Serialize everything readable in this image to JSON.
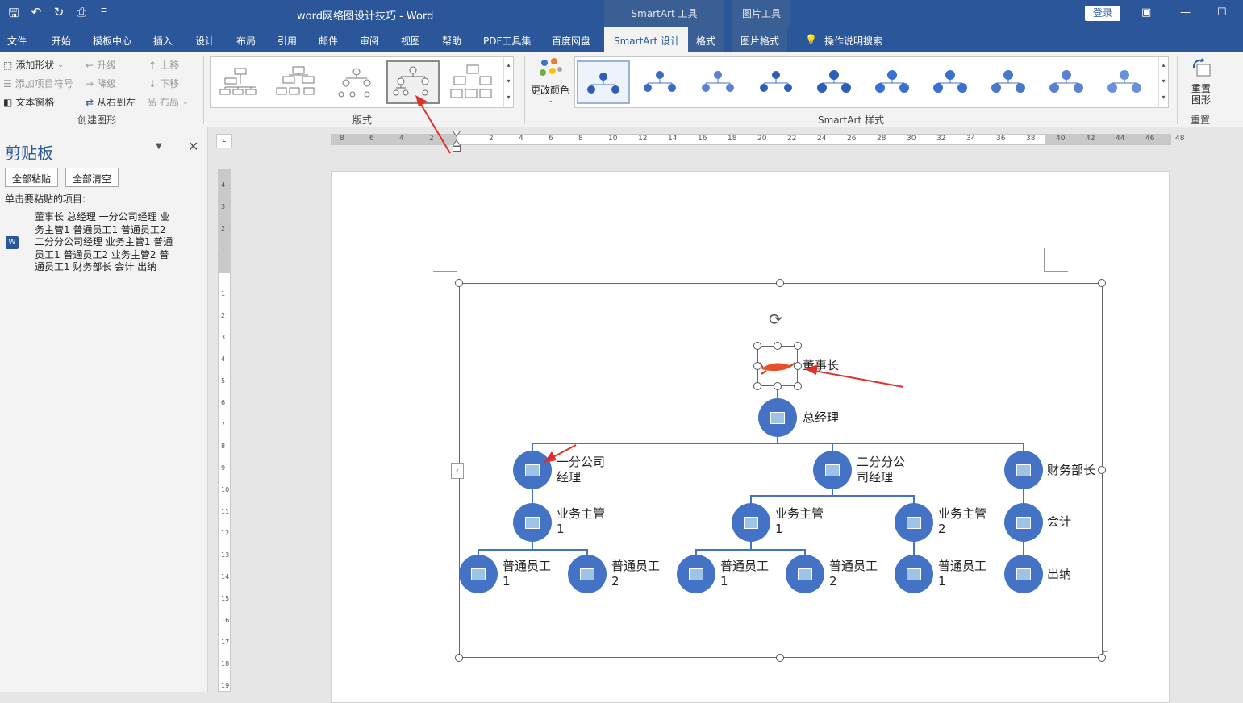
{
  "app": {
    "title": "word网络图设计技巧  -  Word",
    "context_tabs": [
      "SmartArt 工具",
      "图片工具"
    ],
    "login": "登录"
  },
  "tabs": [
    "文件",
    "开始",
    "模板中心",
    "插入",
    "设计",
    "布局",
    "引用",
    "邮件",
    "审阅",
    "视图",
    "帮助",
    "PDF工具集",
    "百度网盘",
    "SmartArt 设计",
    "格式",
    "图片格式",
    "操作说明搜索"
  ],
  "active_tab": "SmartArt 设计",
  "ribbon": {
    "create": {
      "add_shape": "添加形状",
      "add_bullet": "添加项目符号",
      "text_pane": "文本窗格",
      "promote": "升级",
      "demote": "降级",
      "rtl": "从右到左",
      "move_up": "上移",
      "move_down": "下移",
      "layout": "布局",
      "group": "创建图形"
    },
    "layouts_group": "版式",
    "change_colors": "更改颜色",
    "styles_group": "SmartArt 样式",
    "reset_graphic": "重置\n图形",
    "reset_group": "重置"
  },
  "clipboard": {
    "title": "剪贴板",
    "paste_all": "全部粘贴",
    "clear_all": "全部清空",
    "hint": "单击要粘贴的项目:",
    "item": "董事长 总经理 一分公司经理 业务主管1 普通员工1 普通员工2 二分分公司经理 业务主管1 普通员工1 普通员工2 业务主管2 普通员工1 财务部长 会计 出纳"
  },
  "ruler": {
    "h_labels": [
      "8",
      "6",
      "4",
      "2",
      "",
      "2",
      "4",
      "6",
      "8",
      "10",
      "12",
      "14",
      "16",
      "18",
      "20",
      "22",
      "24",
      "26",
      "28",
      "30",
      "32",
      "34",
      "36",
      "38",
      "40",
      "42",
      "44",
      "46",
      "48"
    ],
    "v_labels": [
      "4",
      "3",
      "2",
      "1",
      "",
      "1",
      "2",
      "3",
      "4",
      "5",
      "6",
      "7",
      "8",
      "9",
      "10",
      "11",
      "12",
      "13",
      "14",
      "15",
      "16",
      "17",
      "18",
      "19"
    ]
  },
  "org": {
    "chairman": "董事长",
    "gm": "总经理",
    "b1": "一分公司\n经理",
    "b2": "二分分公\n司经理",
    "fin": "财务部长",
    "b1_sup": "业务主管\n1",
    "b2_sup1": "业务主管\n1",
    "b2_sup2": "业务主管\n2",
    "acct": "会计",
    "cashier": "出纳",
    "e1": "普通员工\n1",
    "e2": "普通员工\n2",
    "e3": "普通员工\n1",
    "e4": "普通员工\n2",
    "e5": "普通员工\n1"
  },
  "colors": {
    "brand": "#2b579a",
    "node": "#4472c4",
    "arrow": "#e0302a"
  }
}
